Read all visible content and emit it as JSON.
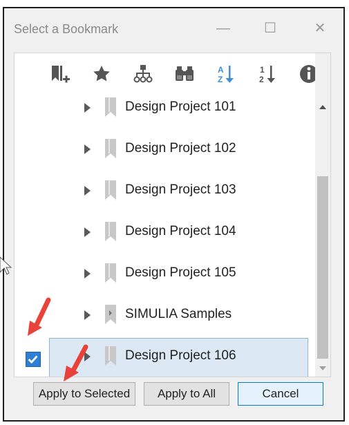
{
  "window": {
    "title": "Select a Bookmark",
    "controls": {
      "minimize": "—",
      "maximize": "☐",
      "close": "✕"
    }
  },
  "toolbar": {
    "buttons": [
      {
        "name": "add-bookmark-icon"
      },
      {
        "name": "favorite-star-icon"
      },
      {
        "name": "hierarchy-tree-icon"
      },
      {
        "name": "binoculars-search-icon"
      },
      {
        "name": "sort-alpha-icon"
      },
      {
        "name": "sort-numeric-icon"
      },
      {
        "name": "info-icon"
      }
    ]
  },
  "bookmarks": {
    "items": [
      {
        "label": "Design Project 101"
      },
      {
        "label": "Design Project 102"
      },
      {
        "label": "Design Project 103"
      },
      {
        "label": "Design Project 104"
      },
      {
        "label": "Design Project 105"
      },
      {
        "label": "SIMULIA Samples"
      },
      {
        "label": "Design Project 106",
        "selected": true,
        "checked": true
      }
    ]
  },
  "buttons": {
    "apply_selected": "Apply to Selected",
    "apply_all": "Apply to All",
    "cancel": "Cancel"
  },
  "colors": {
    "selection_bg": "#dce8f4",
    "checkbox": "#2f7fd4",
    "annotation_arrow": "#e8423a",
    "sort_alpha_icon": "#3a8fd9"
  }
}
